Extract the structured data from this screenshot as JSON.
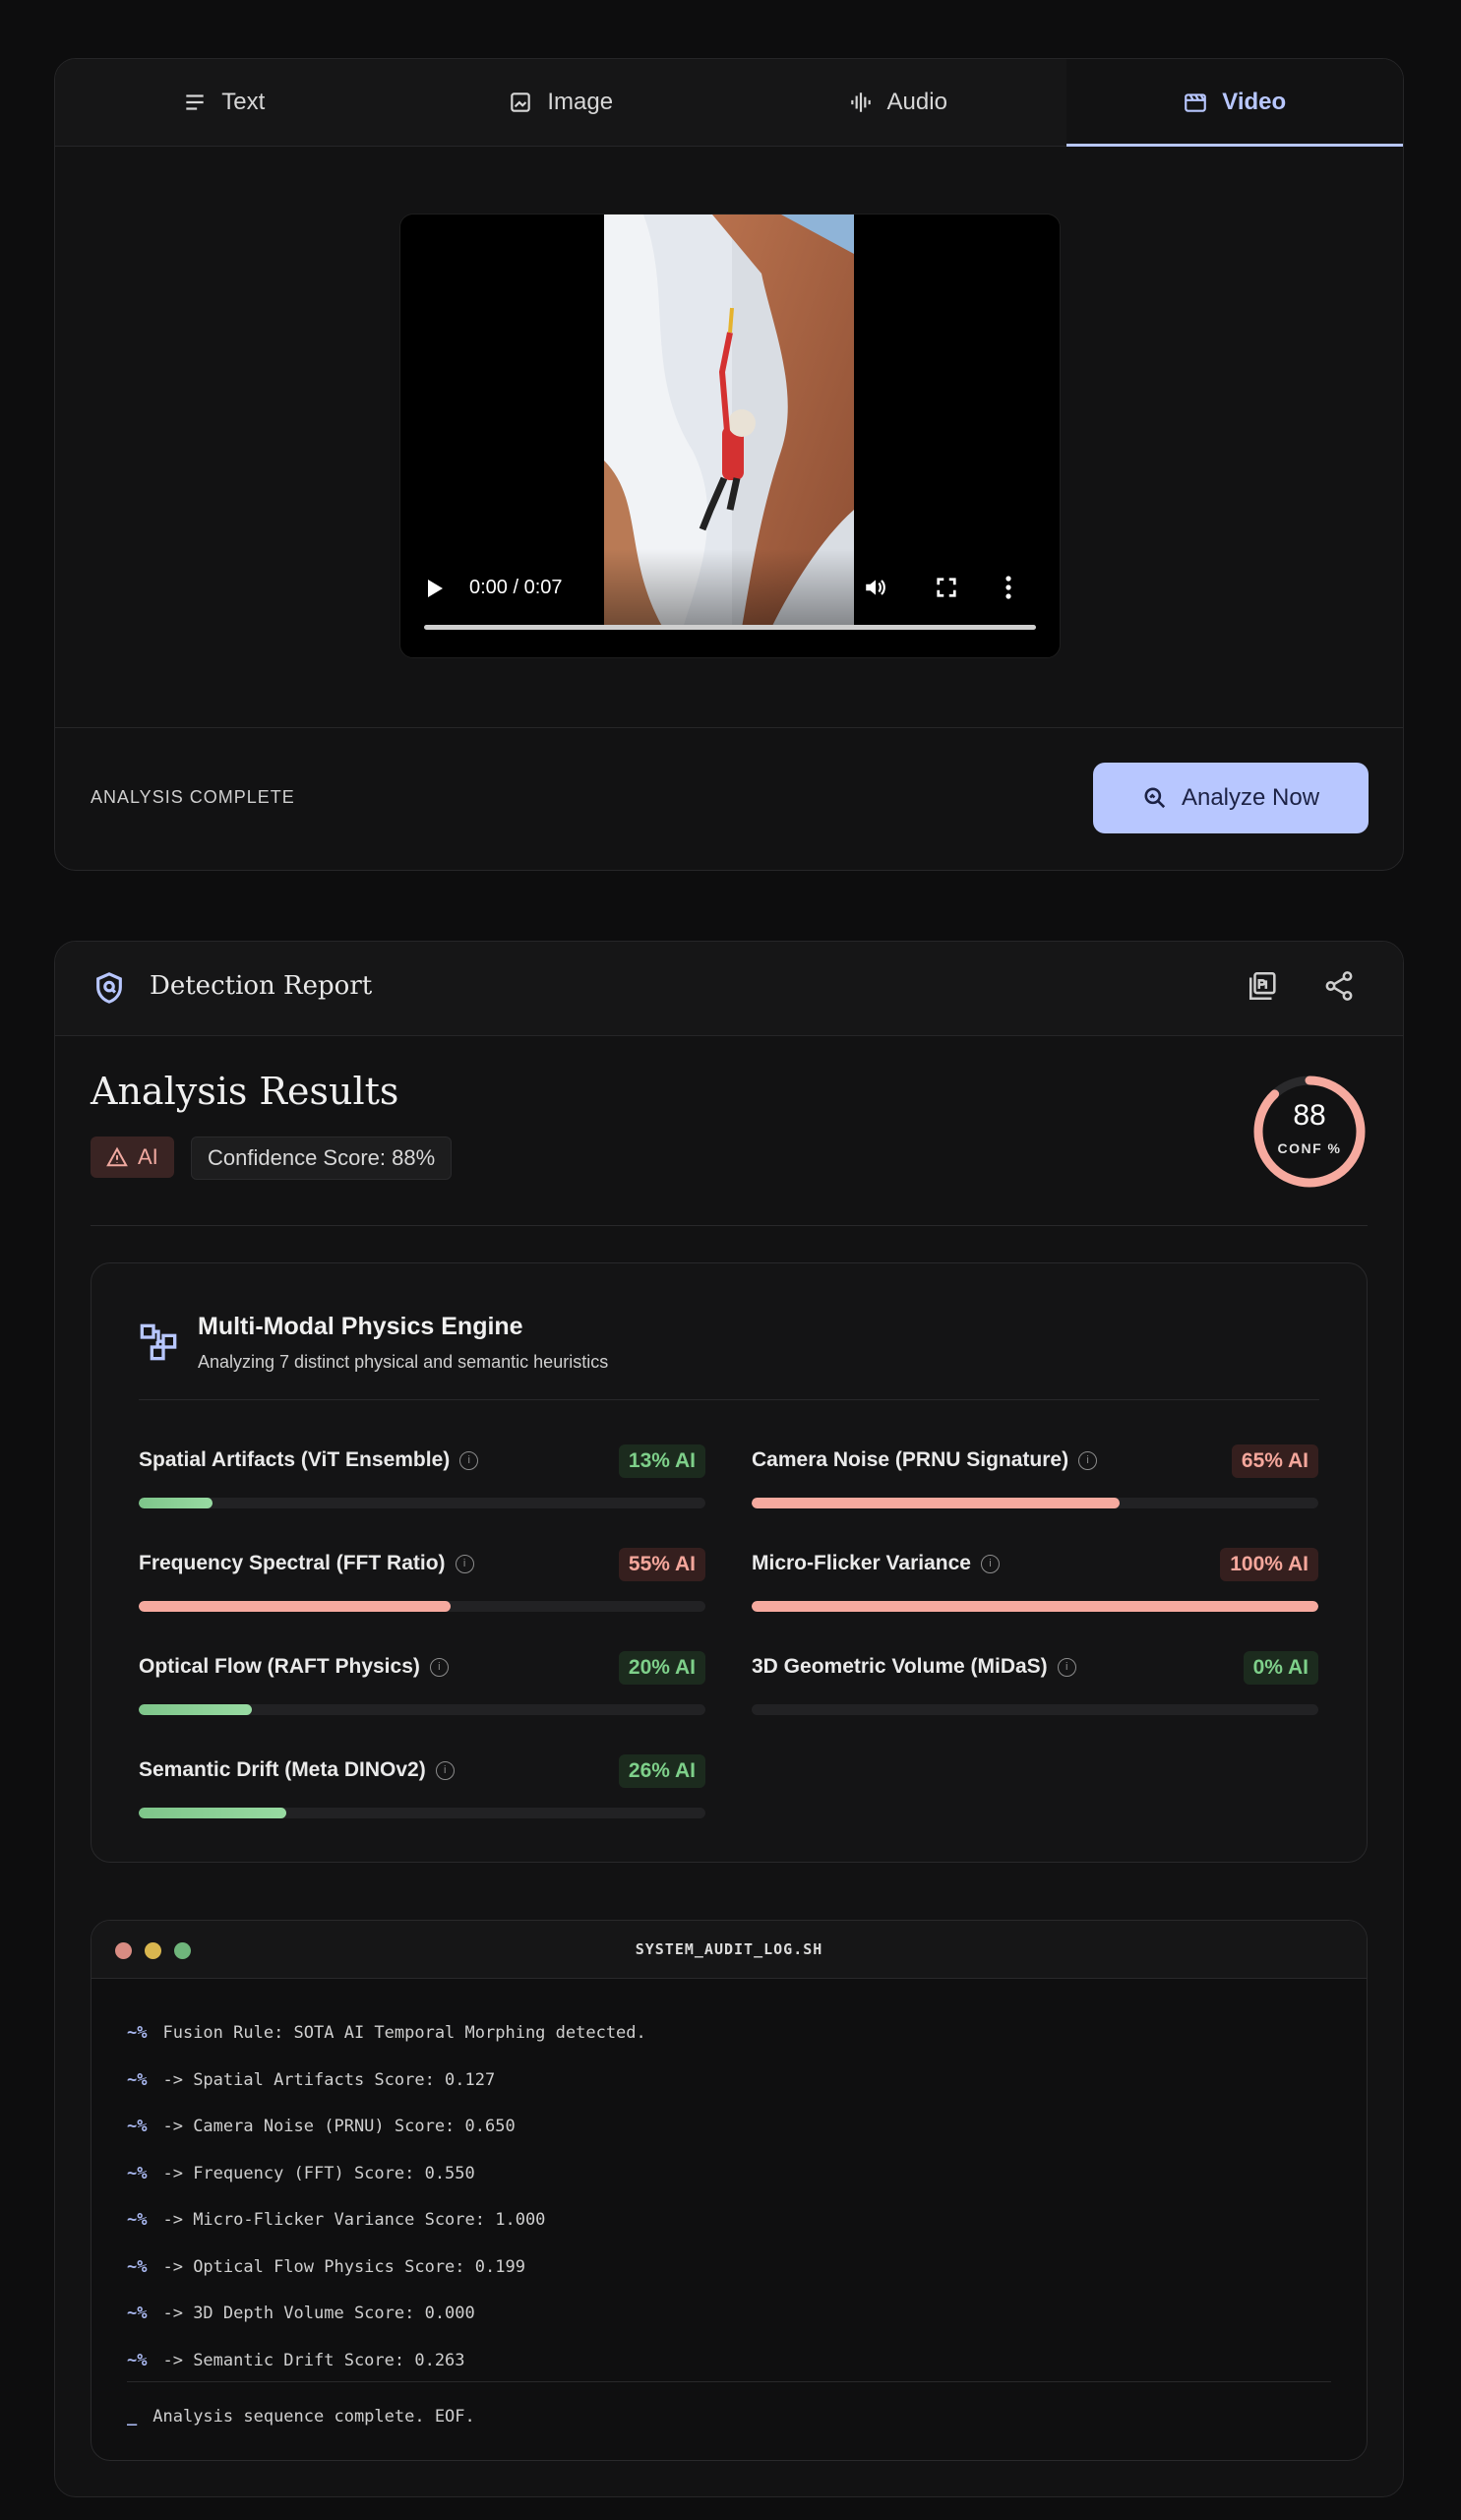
{
  "tabs": [
    {
      "label": "Text",
      "icon": "text-lines-icon"
    },
    {
      "label": "Image",
      "icon": "image-icon"
    },
    {
      "label": "Audio",
      "icon": "audio-wave-icon"
    },
    {
      "label": "Video",
      "icon": "clapperboard-icon",
      "active": true
    }
  ],
  "player": {
    "time": "0:00 / 0:07"
  },
  "upload": {
    "status": "ANALYSIS COMPLETE",
    "analyze_label": "Analyze Now"
  },
  "report": {
    "header_title": "Detection Report",
    "results_title": "Analysis Results",
    "verdict": "AI",
    "confidence_text": "Confidence Score: 88%",
    "gauge_value": "88",
    "gauge_label": "CONF %",
    "gauge_fraction": 0.88
  },
  "engine": {
    "title": "Multi-Modal Physics Engine",
    "subtitle": "Analyzing 7 distinct physical and semantic heuristics",
    "metrics": [
      {
        "name": "Spatial Artifacts (ViT Ensemble)",
        "pct_label": "13% AI",
        "value": 13,
        "level": "low"
      },
      {
        "name": "Camera Noise (PRNU Signature)",
        "pct_label": "65% AI",
        "value": 65,
        "level": "high"
      },
      {
        "name": "Frequency Spectral (FFT Ratio)",
        "pct_label": "55% AI",
        "value": 55,
        "level": "high"
      },
      {
        "name": "Micro-Flicker Variance",
        "pct_label": "100% AI",
        "value": 100,
        "level": "high"
      },
      {
        "name": "Optical Flow (RAFT Physics)",
        "pct_label": "20% AI",
        "value": 20,
        "level": "low"
      },
      {
        "name": "3D Geometric Volume (MiDaS)",
        "pct_label": "0% AI",
        "value": 0,
        "level": "low"
      },
      {
        "name": "Semantic Drift (Meta DINOv2)",
        "pct_label": "26% AI",
        "value": 26,
        "level": "low"
      }
    ]
  },
  "terminal": {
    "title": "SYSTEM_AUDIT_LOG.SH",
    "prompt": "~%",
    "lines": [
      "Fusion Rule: SOTA AI Temporal Morphing detected.",
      "-> Spatial Artifacts Score: 0.127",
      "-> Camera Noise (PRNU) Score: 0.650",
      "-> Frequency (FFT) Score: 0.550",
      "-> Micro-Flicker Variance Score: 1.000",
      "-> Optical Flow Physics Score: 0.199",
      "-> 3D Depth Volume Score: 0.000",
      "-> Semantic Drift Score: 0.263"
    ],
    "cursor": "_",
    "eof": "Analysis sequence complete. EOF."
  },
  "colors": {
    "accent": "#b8c7ff",
    "ai_high": "#f6aa9f",
    "ai_low": "#7ed08a",
    "bg": "#0d0d0e"
  }
}
